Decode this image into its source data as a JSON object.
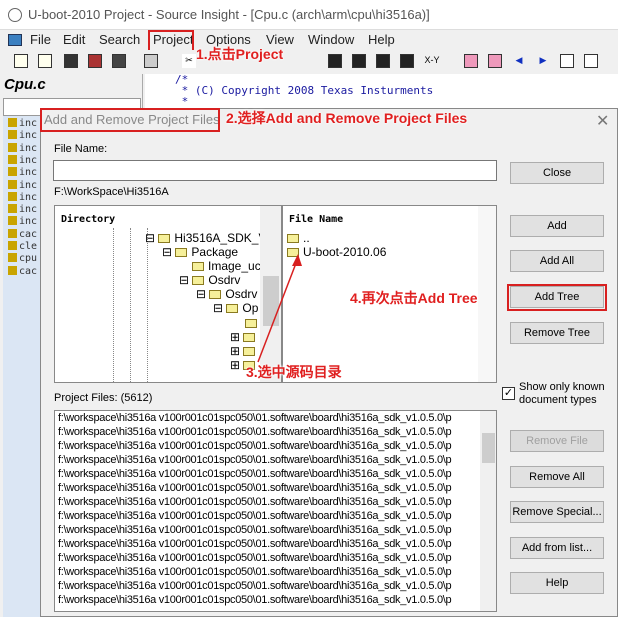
{
  "window": {
    "title": "U-boot-2010 Project - Source Insight - [Cpu.c (arch\\arm\\cpu\\hi3516a)]"
  },
  "menu": [
    "File",
    "Edit",
    "Search",
    "Project",
    "Options",
    "View",
    "Window",
    "Help"
  ],
  "left_panel": {
    "title": "Cpu.c",
    "symbols": [
      "inc",
      "inc",
      "inc",
      "inc",
      "inc",
      "inc",
      "inc",
      "inc",
      "inc",
      "cac",
      "cle",
      "cpu",
      "cac"
    ]
  },
  "editor": {
    "lines": [
      "/*",
      " * (C) Copyright 2008 Texas Insturments",
      " *"
    ]
  },
  "dialog": {
    "title": "Add and Remove Project Files",
    "close_glyph": "✕",
    "file_name_label": "File Name:",
    "file_name_value": "",
    "path": "F:\\WorkSpace\\Hi3516A",
    "directory_header": "Directory",
    "file_header": "File Name",
    "tree": [
      "Hi3516A_SDK_V",
      "Package",
      "Image_uc",
      "Osdrv",
      "Osdrv",
      "Op"
    ],
    "files": [
      "..",
      "U-boot-2010.06"
    ],
    "project_files_label": "Project Files: (5612)",
    "project_files": [
      "f:\\workspace\\hi3516a v100r001c01spc050\\01.software\\board\\hi3516a_sdk_v1.0.5.0\\p"
    ],
    "project_file_rows": 14,
    "show_known_label": "Show only known document types",
    "show_known_checked": true,
    "buttons": {
      "close": "Close",
      "add": "Add",
      "add_all": "Add All",
      "add_tree": "Add Tree",
      "remove_tree": "Remove Tree",
      "remove_file": "Remove File",
      "remove_all": "Remove All",
      "remove_special": "Remove Special...",
      "add_from_list": "Add from list...",
      "help": "Help"
    }
  },
  "annotations": {
    "step1": "1.点击Project",
    "step2": "2.选择Add and Remove Project Files",
    "step3": "3.选中源码目录",
    "step4": "4.再次点击Add Tree"
  }
}
